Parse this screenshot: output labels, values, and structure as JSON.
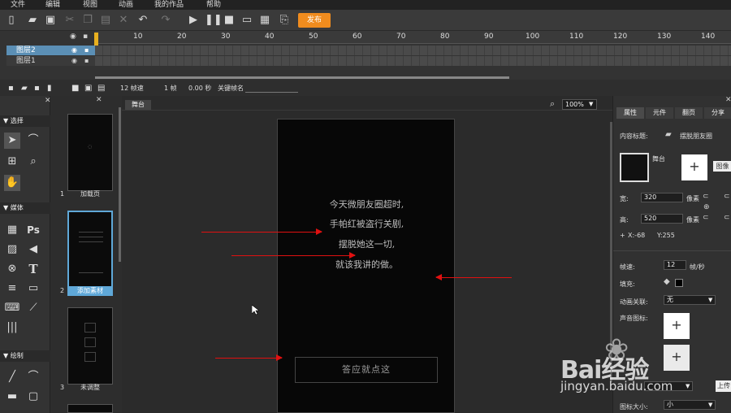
{
  "menu": [
    "文件",
    "编辑",
    "视图",
    "动画",
    "我的作品",
    "帮助"
  ],
  "toolbar": {
    "publish_label": "发布"
  },
  "timeline": {
    "ruler": [
      "10",
      "20",
      "30",
      "40",
      "50",
      "60",
      "70",
      "80",
      "90",
      "100",
      "110",
      "120",
      "130",
      "140"
    ],
    "layers": [
      "图层2",
      "图层1"
    ],
    "fps": "12 帧速",
    "frame": "1 帧",
    "time": "0.00 秒",
    "keyframe_label": "关键帧名"
  },
  "tools": {
    "sections": [
      "选择",
      "媒体",
      "绘制"
    ],
    "ps_label": "Ps",
    "text_label": "T"
  },
  "pages": {
    "items": [
      {
        "num": "1",
        "label": "加载页"
      },
      {
        "num": "2",
        "label": "添加素材"
      },
      {
        "num": "3",
        "label": "未调整"
      }
    ]
  },
  "stage": {
    "tab": "舞台",
    "zoom": "100%",
    "poem": [
      "今天微朋友圈超时,",
      "手帕红被盗行关剧,",
      "摆脱她这一切,",
      "就该我讲的做。"
    ],
    "button": "答应就点这"
  },
  "props": {
    "tabs": [
      "属性",
      "元件",
      "翻页",
      "分享"
    ],
    "content_title_label": "内容标题:",
    "content_title": "摆脱朋友圈",
    "stage_label": "舞台",
    "image_btn": "图像",
    "width_label": "宽:",
    "width": "320",
    "height_label": "高:",
    "height": "520",
    "unit": "像素",
    "x": "X:-68",
    "y": "Y:255",
    "fps_label": "帧速:",
    "fps": "12",
    "fps_unit": "帧/秒",
    "fill_label": "填充:",
    "anim_label": "动画关联:",
    "anim_value": "无",
    "sound_label": "声音图标:",
    "upload_label": "上传",
    "icon_size_label": "图标大小:",
    "icon_size_value": "小"
  },
  "watermark": {
    "brand": "Bai经验",
    "url": "jingyan.baidu.com"
  }
}
